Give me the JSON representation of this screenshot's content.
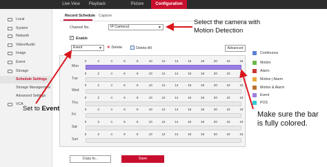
{
  "topnav": {
    "live_view": "Live View",
    "playback": "Playback",
    "picture": "Picture",
    "configuration": "Configuration"
  },
  "sidebar": {
    "items": [
      {
        "label": "Local",
        "icon": "monitor-icon"
      },
      {
        "label": "System",
        "icon": "system-icon"
      },
      {
        "label": "Network",
        "icon": "network-icon"
      },
      {
        "label": "Video/Audio",
        "icon": "video-icon"
      },
      {
        "label": "Image",
        "icon": "image-icon"
      },
      {
        "label": "Event",
        "icon": "event-icon"
      },
      {
        "label": "Storage",
        "icon": "storage-icon"
      }
    ],
    "subitems": [
      {
        "label": "Schedule Settings",
        "active": true
      },
      {
        "label": "Storage Management"
      },
      {
        "label": "Advanced Settings"
      }
    ],
    "vca": {
      "label": "VCA",
      "icon": "vca-icon"
    }
  },
  "tabs": {
    "record_schedule": "Record Schedule",
    "capture": "Capture"
  },
  "form": {
    "channel_label": "Channel No.",
    "channel_value": "IP Camera1",
    "enable_label": "Enable",
    "enable_checked": "✓"
  },
  "toolbar": {
    "type_value": "Event",
    "delete_label": "Delete",
    "delete_all_label": "Delete All",
    "advanced_label": "Advanced"
  },
  "schedule": {
    "hours": [
      "0",
      "2",
      "4",
      "6",
      "8",
      "10",
      "12",
      "14",
      "16",
      "18",
      "20",
      "22",
      "24"
    ],
    "days": [
      {
        "label": "Mon",
        "filled": true
      },
      {
        "label": "Tue",
        "filled": false
      },
      {
        "label": "Wed",
        "filled": false
      },
      {
        "label": "Thu",
        "filled": false
      },
      {
        "label": "Fri",
        "filled": false
      },
      {
        "label": "Sat",
        "filled": false
      },
      {
        "label": "Sun",
        "filled": false
      }
    ],
    "fill_color": "#9b7fe0"
  },
  "legend": [
    {
      "label": "Continuous",
      "color": "#5b7fd6"
    },
    {
      "label": "Motion",
      "color": "#6db84a"
    },
    {
      "label": "Alarm",
      "color": "#c8352f"
    },
    {
      "label": "Motion | Alarm",
      "color": "#e8a93a"
    },
    {
      "label": "Motion & Alarm",
      "color": "#b8712e"
    },
    {
      "label": "Event",
      "color": "#9b7fe0"
    },
    {
      "label": "POS",
      "color": "#35c9d6"
    }
  ],
  "buttons": {
    "copy_label": "Copy to...",
    "save_label": "Save"
  },
  "annotations": {
    "camera_line1": "Select the camera with",
    "camera_line2": "Motion Detection",
    "bar_line1": "Make sure the bar",
    "bar_line2": "is fully colored.",
    "event_prefix": "Set to ",
    "event_bold": "Event",
    "arrow_color": "#d9161c"
  }
}
